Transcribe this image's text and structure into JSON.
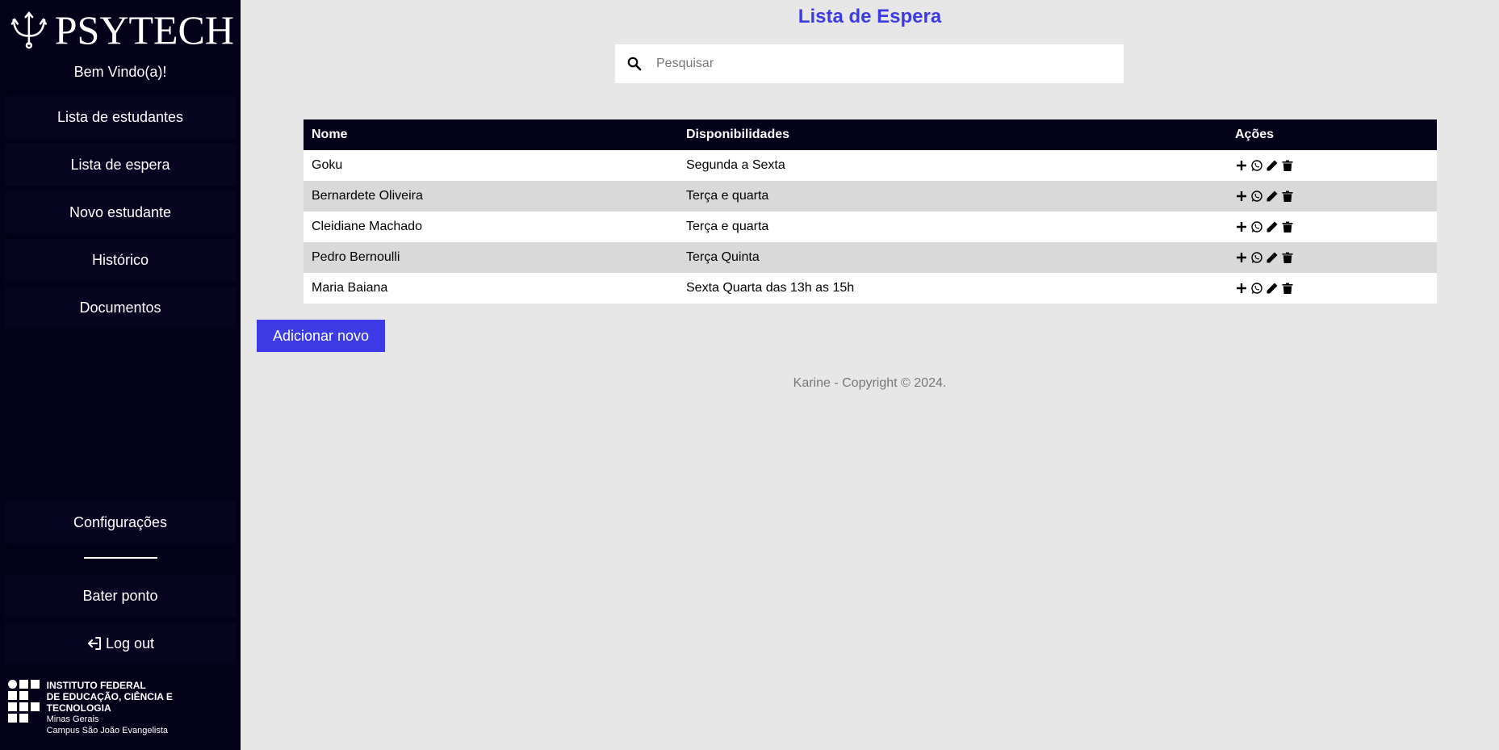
{
  "sidebar": {
    "logo_text": "PSYTECH",
    "welcome": "Bem Vindo(a)!",
    "nav": [
      {
        "label": "Lista de estudantes"
      },
      {
        "label": "Lista de espera"
      },
      {
        "label": "Novo estudante"
      },
      {
        "label": "Histórico"
      },
      {
        "label": "Documentos"
      }
    ],
    "settings": "Configurações",
    "clock_in": "Bater ponto",
    "logout": "Log out",
    "institution": {
      "line1": "INSTITUTO FEDERAL",
      "line2": "DE EDUCAÇÃO, CIÊNCIA E TECNOLOGIA",
      "line3": "Minas Gerais",
      "line4": "Campus São João Evangelista"
    }
  },
  "main": {
    "title": "Lista de Espera",
    "search": {
      "placeholder": "Pesquisar",
      "icon": "search-icon"
    },
    "table": {
      "headers": [
        "Nome",
        "Disponibilidades",
        "Ações"
      ],
      "rows": [
        {
          "name": "Goku",
          "availability": "Segunda a Sexta"
        },
        {
          "name": "Bernardete Oliveira",
          "availability": "Terça e quarta"
        },
        {
          "name": "Cleidiane Machado",
          "availability": "Terça e quarta"
        },
        {
          "name": "Pedro Bernoulli",
          "availability": "Terça Quinta"
        },
        {
          "name": "Maria Baiana",
          "availability": "Sexta Quarta das 13h as 15h"
        }
      ],
      "action_icons": [
        "plus-icon",
        "whatsapp-icon",
        "pencil-icon",
        "trash-icon"
      ]
    },
    "add_button": "Adicionar novo",
    "footer": "Karine - Copyright © 2024."
  },
  "colors": {
    "sidebar_bg": "#03001a",
    "accent": "#3d3be6",
    "page_bg": "#e7e7e7"
  }
}
